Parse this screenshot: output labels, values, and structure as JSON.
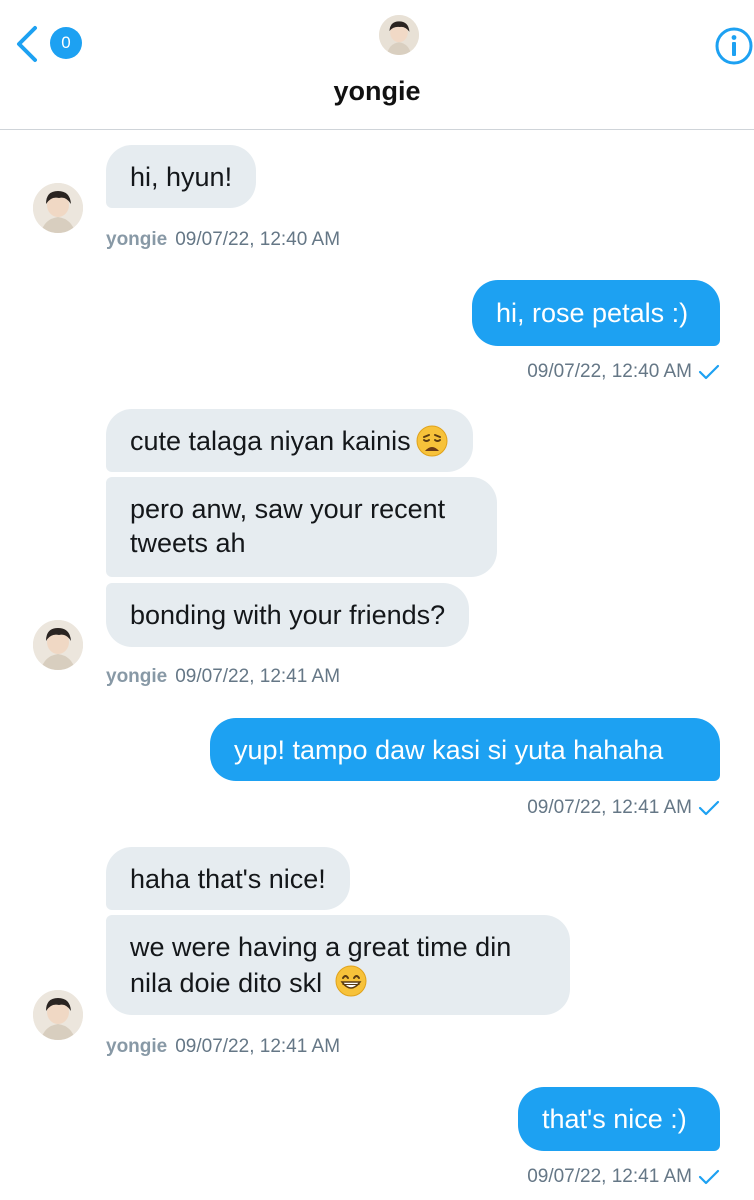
{
  "header": {
    "unread_count": "0",
    "contact_name": "yongie"
  },
  "messages": [
    {
      "dir": "received",
      "text": "hi, hyun!"
    },
    {
      "meta_sender": "yongie",
      "meta_time": "09/07/22, 12:40 AM"
    },
    {
      "dir": "sent",
      "text": "hi, rose petals :)"
    },
    {
      "meta_time": "09/07/22, 12:40 AM"
    },
    {
      "dir": "received",
      "text": "cute talaga niyan kainis",
      "emoji": "weary-face"
    },
    {
      "dir": "received",
      "text": "pero anw, saw your recent tweets ah"
    },
    {
      "dir": "received",
      "text": "bonding with your friends?"
    },
    {
      "meta_sender": "yongie",
      "meta_time": "09/07/22, 12:41 AM"
    },
    {
      "dir": "sent",
      "text": "yup! tampo daw kasi si yuta hahaha"
    },
    {
      "meta_time": "09/07/22, 12:41 AM"
    },
    {
      "dir": "received",
      "text": "haha that's nice!"
    },
    {
      "dir": "received",
      "text": "we were having a great time din nila doie dito skl",
      "emoji": "grinning-face"
    },
    {
      "meta_sender": "yongie",
      "meta_time": "09/07/22, 12:41 AM"
    },
    {
      "dir": "sent",
      "text": "that's nice :)"
    },
    {
      "meta_time": "09/07/22, 12:41 AM"
    }
  ],
  "colors": {
    "accent": "#1da1f2",
    "received_bubble": "#e6ecf0",
    "meta_text": "#657786"
  }
}
